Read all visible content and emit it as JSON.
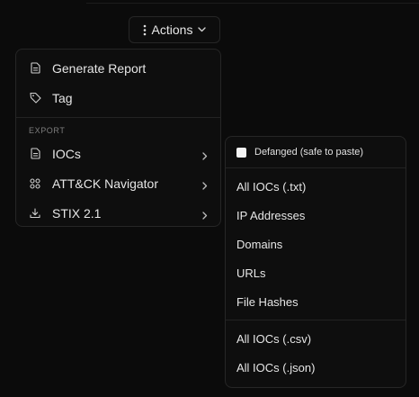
{
  "actions_button": {
    "label": "Actions"
  },
  "menu": {
    "items": [
      {
        "label": "Generate Report",
        "icon": "document-icon"
      },
      {
        "label": "Tag",
        "icon": "tag-icon"
      }
    ],
    "export_section_label": "EXPORT",
    "export_items": [
      {
        "label": "IOCs",
        "icon": "document-icon"
      },
      {
        "label": "ATT&CK Navigator",
        "icon": "grid-icon"
      },
      {
        "label": "STIX 2.1",
        "icon": "download-icon"
      }
    ]
  },
  "ioc_submenu": {
    "defanged_label": "Defanged (safe to paste)",
    "defanged_checked": false,
    "group1": [
      "All IOCs (.txt)",
      "IP Addresses",
      "Domains",
      "URLs",
      "File Hashes"
    ],
    "group2": [
      "All IOCs (.csv)",
      "All IOCs (.json)"
    ]
  }
}
